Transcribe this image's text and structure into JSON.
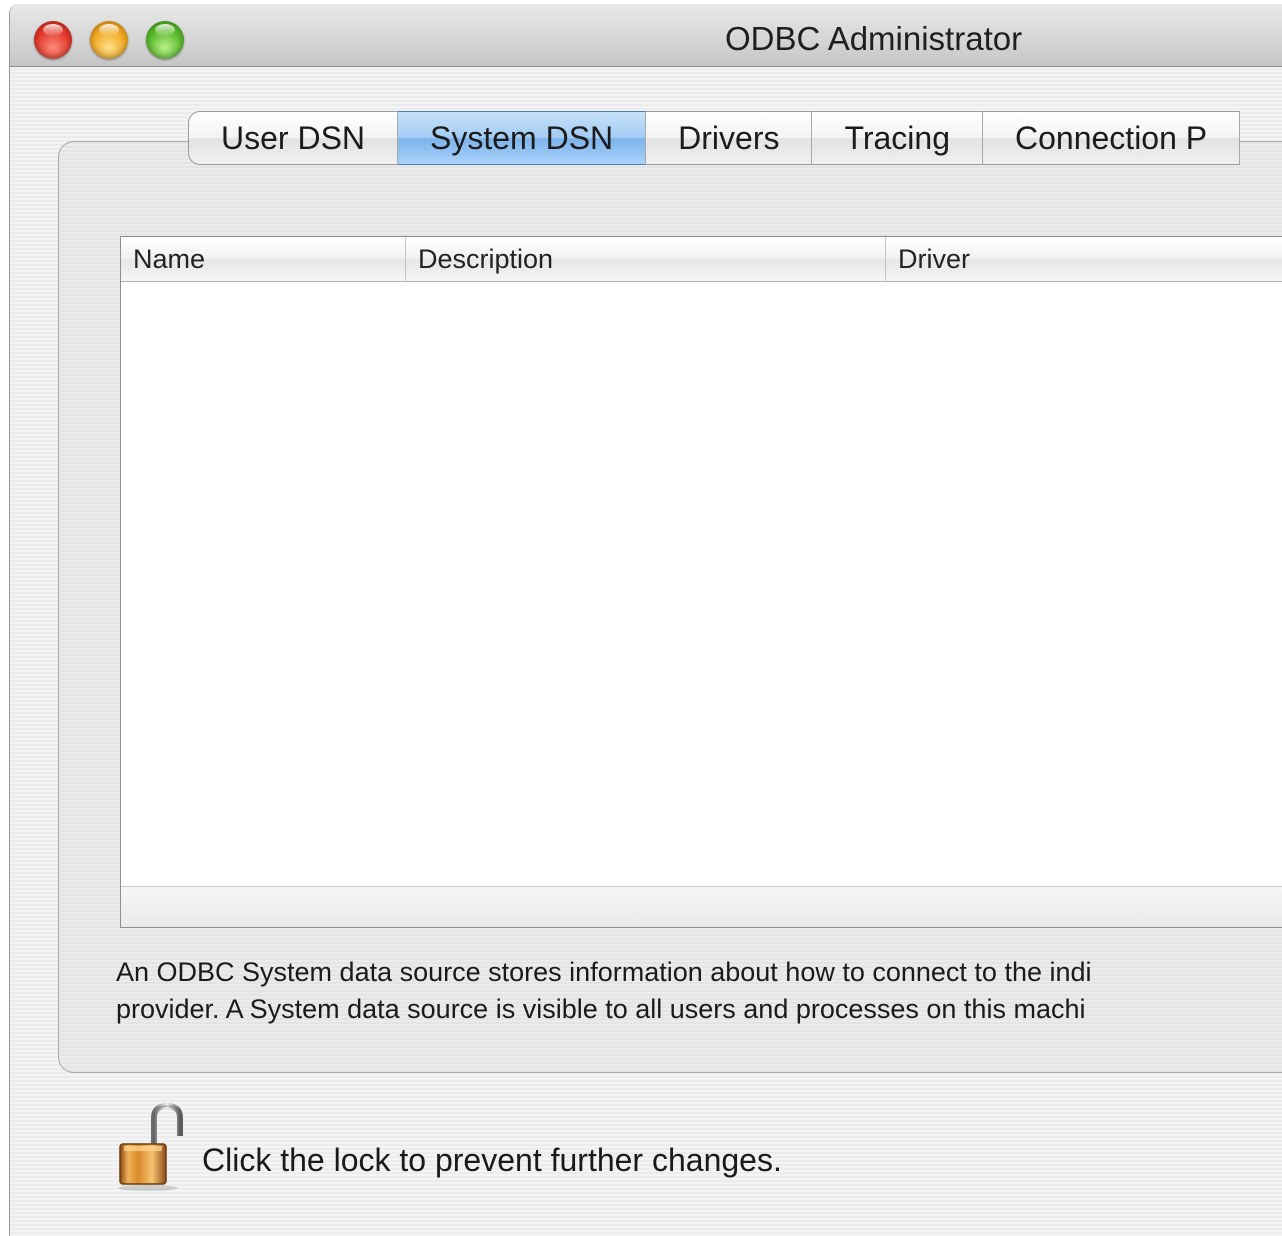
{
  "window": {
    "title": "ODBC Administrator",
    "controls": [
      "close",
      "minimize",
      "zoom"
    ]
  },
  "tabs": [
    {
      "label": "User DSN",
      "active": false
    },
    {
      "label": "System DSN",
      "active": true
    },
    {
      "label": "Drivers",
      "active": false
    },
    {
      "label": "Tracing",
      "active": false
    },
    {
      "label": "Connection P",
      "active": false
    }
  ],
  "table": {
    "columns": [
      "Name",
      "Description",
      "Driver"
    ],
    "rows": []
  },
  "description": {
    "line1": "An ODBC System data source stores information about how to connect to the indi",
    "line2": "provider. A System data source is visible to all users and processes on this machi"
  },
  "lock": {
    "icon": "open-lock-icon",
    "message": "Click the lock to prevent further changes."
  },
  "colors": {
    "active_tab": "#a2cbf3",
    "close": "#e0382a",
    "minimize": "#f0a620",
    "zoom": "#58b82a"
  }
}
